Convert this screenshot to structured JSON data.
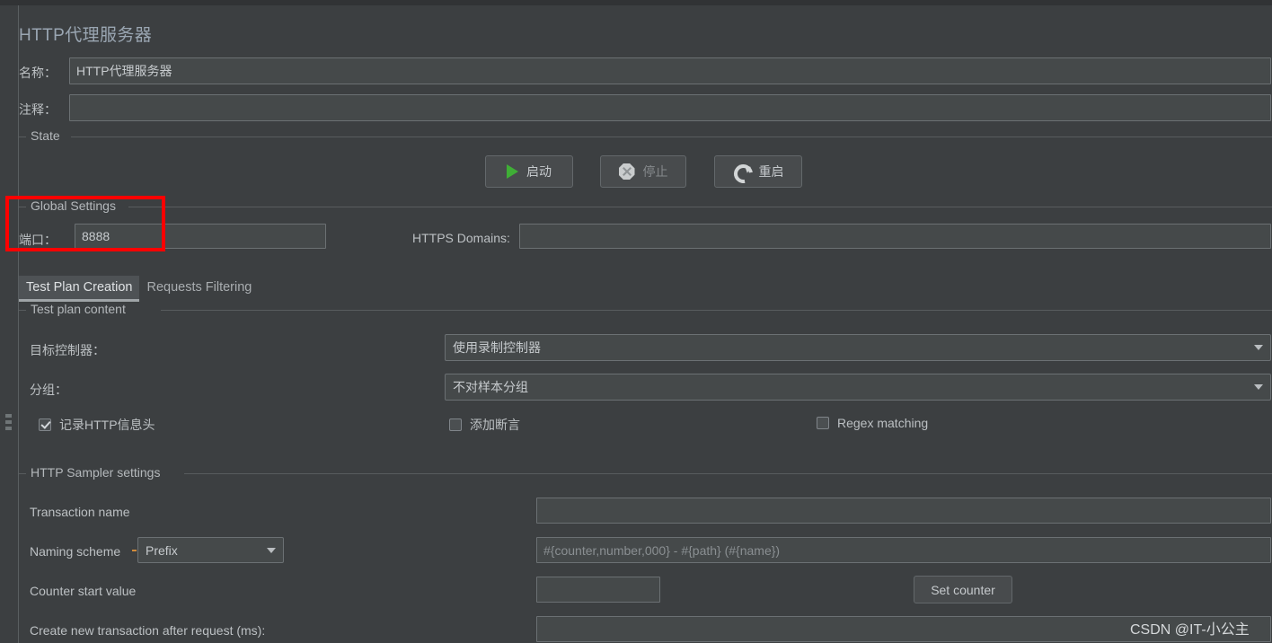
{
  "panel": {
    "title": "HTTP代理服务器"
  },
  "fields": {
    "name_label": "名称：",
    "name_value": "HTTP代理服务器",
    "comment_label": "注释：",
    "comment_value": ""
  },
  "state_group": {
    "title": "State",
    "buttons": [
      {
        "label": "启动",
        "icon": "play-icon",
        "enabled": true
      },
      {
        "label": "停止",
        "icon": "stop-icon",
        "enabled": false
      },
      {
        "label": "重启",
        "icon": "restart-icon",
        "enabled": true
      }
    ]
  },
  "global_settings": {
    "title": "Global Settings",
    "port_label": "端口：",
    "port_value": "8888",
    "https_domains_label": "HTTPS Domains:",
    "https_domains_value": ""
  },
  "tabs": [
    {
      "label": "Test Plan Creation",
      "active": true
    },
    {
      "label": "Requests Filtering",
      "active": false
    }
  ],
  "test_plan_content": {
    "title": "Test plan content",
    "target_controller_label": "目标控制器：",
    "target_controller_value": "使用录制控制器",
    "grouping_label": "分组：",
    "grouping_value": "不对样本分组",
    "checkboxes": [
      {
        "label": "记录HTTP信息头",
        "checked": true
      },
      {
        "label": "添加断言",
        "checked": false
      },
      {
        "label": "Regex matching",
        "checked": false
      }
    ]
  },
  "sampler_settings": {
    "title": "HTTP Sampler settings",
    "transaction_name_label": "Transaction name",
    "transaction_name_value": "",
    "naming_scheme_label": "Naming scheme",
    "naming_scheme_value": "Prefix",
    "naming_pattern_placeholder": "#{counter,number,000} - #{path} (#{name})",
    "naming_pattern_value": "",
    "counter_start_label": "Counter start value",
    "counter_start_value": "",
    "set_counter_label": "Set counter",
    "new_transaction_label": "Create new transaction after request (ms):",
    "new_transaction_value": ""
  },
  "annotation": {
    "color": "#ff0000"
  },
  "watermark": {
    "text": "CSDN @IT-小公主"
  }
}
